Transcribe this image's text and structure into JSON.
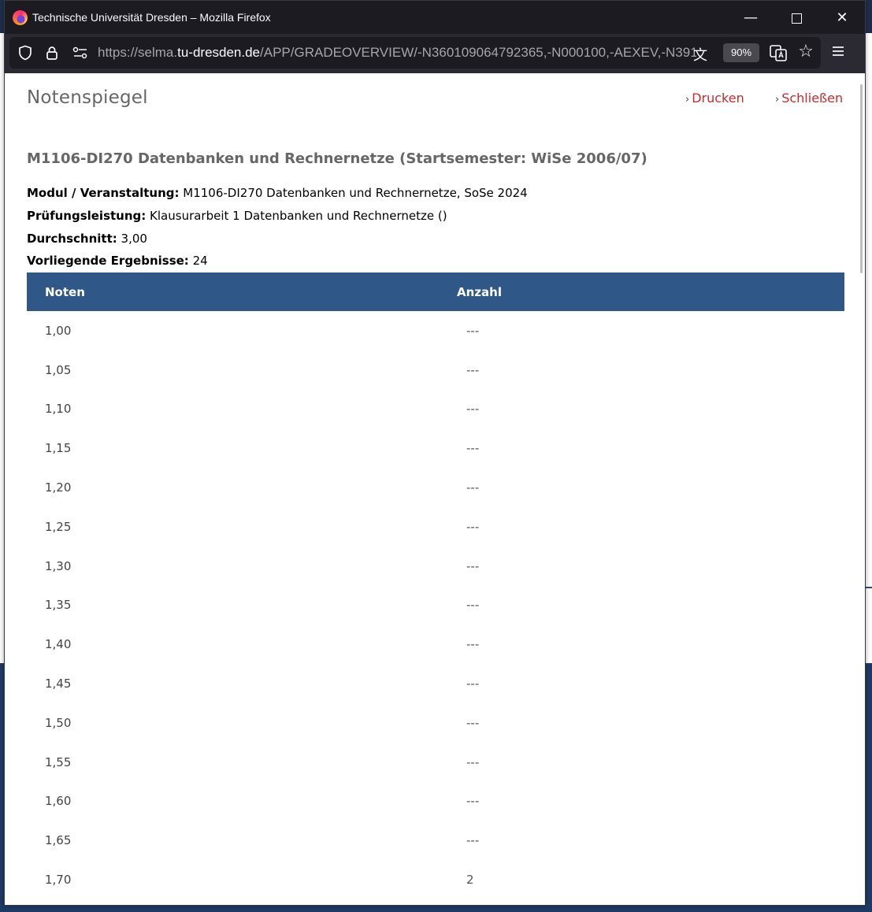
{
  "browser": {
    "window_title": "Technische Universität Dresden – Mozilla Firefox",
    "url_prefix": "https://selma.",
    "url_host": "tu-dresden.de",
    "url_path": "/APP/GRADEOVERVIEW/-N360109064792365,-N000100,-AEXEV,-N391",
    "zoom": "90%"
  },
  "page": {
    "title": "Notenspiegel",
    "print_label": "Drucken",
    "close_label": "Schließen",
    "module_title": "M1106-DI270 Datenbanken und Rechnernetze (Startsemester: WiSe 2006/07)",
    "info": {
      "modul_label": "Modul / Veranstaltung:",
      "modul_value": " M1106-DI270 Datenbanken und Rechnernetze, SoSe 2024",
      "pruefung_label": "Prüfungsleistung:",
      "pruefung_value": " Klausurarbeit 1 Datenbanken und Rechnernetze ()",
      "durchschnitt_label": "Durchschnitt:",
      "durchschnitt_value": " 3,00",
      "ergebnisse_label": "Vorliegende Ergebnisse:",
      "ergebnisse_value": " 24"
    },
    "table": {
      "col_noten": "Noten",
      "col_anzahl": "Anzahl",
      "rows": [
        {
          "note": "1,00",
          "anzahl": "---"
        },
        {
          "note": "1,05",
          "anzahl": "---"
        },
        {
          "note": "1,10",
          "anzahl": "---"
        },
        {
          "note": "1,15",
          "anzahl": "---"
        },
        {
          "note": "1,20",
          "anzahl": "---"
        },
        {
          "note": "1,25",
          "anzahl": "---"
        },
        {
          "note": "1,30",
          "anzahl": "---"
        },
        {
          "note": "1,35",
          "anzahl": "---"
        },
        {
          "note": "1,40",
          "anzahl": "---"
        },
        {
          "note": "1,45",
          "anzahl": "---"
        },
        {
          "note": "1,50",
          "anzahl": "---"
        },
        {
          "note": "1,55",
          "anzahl": "---"
        },
        {
          "note": "1,60",
          "anzahl": "---"
        },
        {
          "note": "1,65",
          "anzahl": "---"
        },
        {
          "note": "1,70",
          "anzahl": "2"
        }
      ]
    }
  },
  "colors": {
    "accent_red": "#c72b2b",
    "table_header": "#2f5889",
    "title_gray": "#666666"
  }
}
